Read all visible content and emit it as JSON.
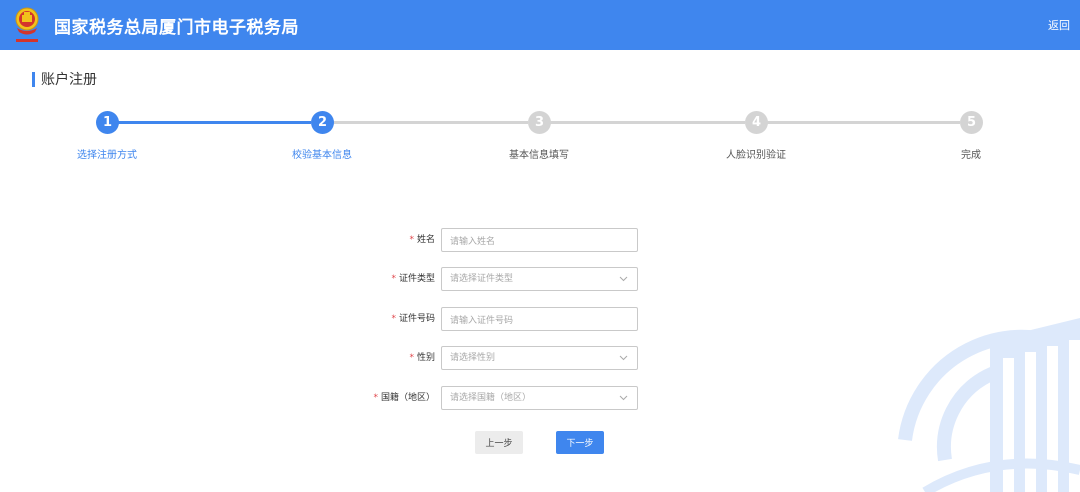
{
  "header": {
    "title": "国家税务总局厦门市电子税务局",
    "back_label": "返回",
    "bg_color": "#3f86ee"
  },
  "page": {
    "title": "账户注册"
  },
  "steps": [
    {
      "number": "1",
      "label": "选择注册方式",
      "state": "done"
    },
    {
      "number": "2",
      "label": "校验基本信息",
      "state": "active"
    },
    {
      "number": "3",
      "label": "基本信息填写",
      "state": "pending"
    },
    {
      "number": "4",
      "label": "人脸识别验证",
      "state": "pending"
    },
    {
      "number": "5",
      "label": "完成",
      "state": "pending"
    }
  ],
  "form": {
    "name": {
      "label": "姓名",
      "placeholder": "请输入姓名",
      "value": ""
    },
    "id_type": {
      "label": "证件类型",
      "placeholder": "请选择证件类型"
    },
    "id_number": {
      "label": "证件号码",
      "placeholder": "请输入证件号码",
      "value": ""
    },
    "gender": {
      "label": "性别",
      "placeholder": "请选择性别"
    },
    "nationality": {
      "label": "国籍（地区）",
      "placeholder": "请选择国籍（地区）"
    }
  },
  "buttons": {
    "prev_label": "上一步",
    "next_label": "下一步"
  },
  "colors": {
    "accent": "#3f86ee",
    "inactive": "#d4d4d4",
    "required": "#e0464b"
  },
  "icons": {
    "logo": "tax-emblem-icon",
    "select_arrow": "chevron-down-icon"
  }
}
